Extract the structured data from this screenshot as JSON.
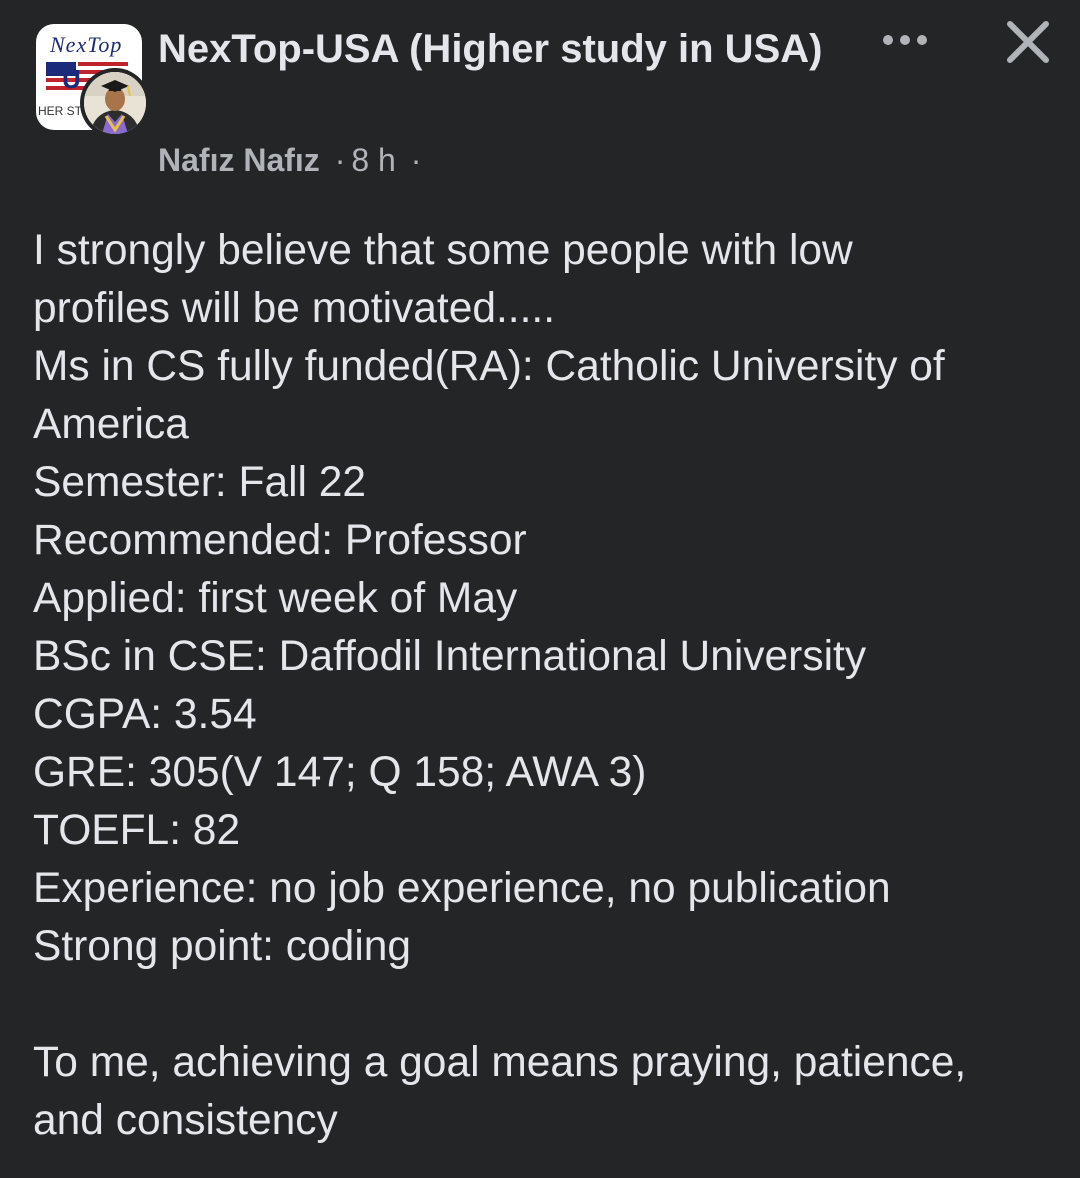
{
  "post": {
    "group_name": "NexTop-USA (Higher study in USA)",
    "group_logo_text": "NexTop",
    "group_logo_subtext": "HER ST",
    "author": "Nafız Nafız",
    "separator": "·",
    "time": "8 h",
    "trailing_separator": "·",
    "body_lines": [
      "I strongly believe that some people with low",
      "profiles will be motivated.....",
      "Ms in CS fully funded(RA): Catholic University of",
      "America",
      "Semester: Fall 22",
      "Recommended: Professor",
      "Applied: first week of May",
      "BSc in CSE: Daffodil International University",
      "CGPA: 3.54",
      "GRE: 305(V 147; Q 158; AWA 3)",
      "TOEFL: 82",
      "Experience: no job experience, no publication",
      "Strong point: coding"
    ],
    "closing_lines": [
      "To me, achieving a goal means praying, patience,",
      "and consistency"
    ]
  },
  "icons": {
    "more": "more-horizontal-icon",
    "close": "close-icon"
  },
  "colors": {
    "background": "#242526",
    "primary_text": "#e4e6eb",
    "secondary_text": "#b0b3b8"
  }
}
